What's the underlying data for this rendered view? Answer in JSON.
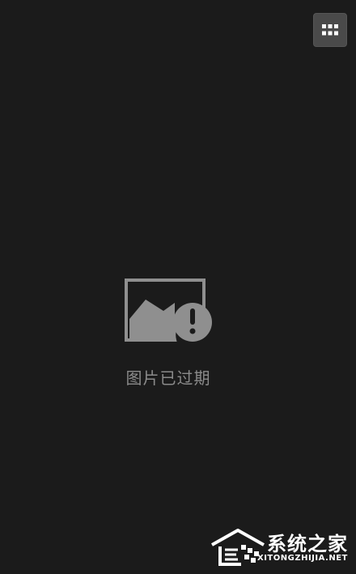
{
  "viewer": {
    "grid_button_icon": "grid-icon",
    "expired_icon": "image-expired-icon",
    "expired_message": "图片已过期"
  },
  "watermark": {
    "title": "系统之家",
    "url": "XITONGZHIJIA.NET"
  },
  "colors": {
    "background": "#1b1b1b",
    "icon_gray": "#8f8f8f",
    "text_gray": "#8a8a8a",
    "button_bg": "#4a4a4a"
  }
}
